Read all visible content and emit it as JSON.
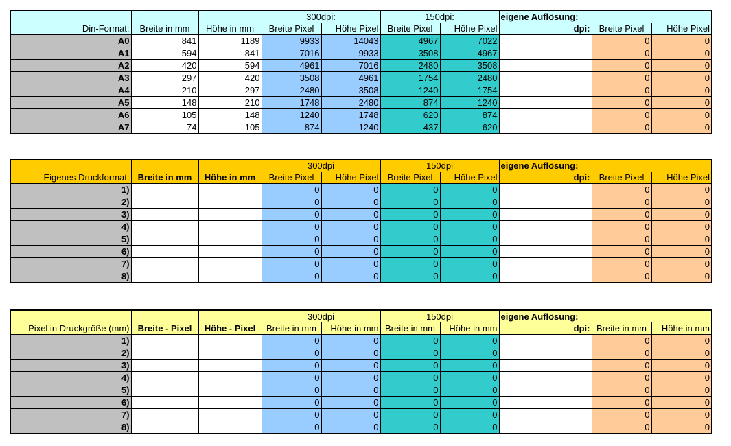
{
  "table1": {
    "header_dpi": {
      "dpi300": "300dpi:",
      "dpi150": "150dpi:",
      "custom": "eigene Auflösung:"
    },
    "header_cols": {
      "label": "Din-Format:",
      "w": "Breite in mm",
      "h": "Höhe in mm",
      "w300": "Breite Pixel",
      "h300": "Höhe Pixel",
      "w150": "Breite Pixel",
      "h150": "Höhe Pixel",
      "dpi": "dpi:",
      "wc": "Breite Pixel",
      "hc": "Höhe Pixel"
    },
    "rows": [
      {
        "label": "A0",
        "w": "841",
        "h": "1189",
        "w300": "9933",
        "h300": "14043",
        "w150": "4967",
        "h150": "7022",
        "dpi": "",
        "wc": "0",
        "hc": "0"
      },
      {
        "label": "A1",
        "w": "594",
        "h": "841",
        "w300": "7016",
        "h300": "9933",
        "w150": "3508",
        "h150": "4967",
        "dpi": "",
        "wc": "0",
        "hc": "0"
      },
      {
        "label": "A2",
        "w": "420",
        "h": "594",
        "w300": "4961",
        "h300": "7016",
        "w150": "2480",
        "h150": "3508",
        "dpi": "",
        "wc": "0",
        "hc": "0"
      },
      {
        "label": "A3",
        "w": "297",
        "h": "420",
        "w300": "3508",
        "h300": "4961",
        "w150": "1754",
        "h150": "2480",
        "dpi": "",
        "wc": "0",
        "hc": "0"
      },
      {
        "label": "A4",
        "w": "210",
        "h": "297",
        "w300": "2480",
        "h300": "3508",
        "w150": "1240",
        "h150": "1754",
        "dpi": "",
        "wc": "0",
        "hc": "0"
      },
      {
        "label": "A5",
        "w": "148",
        "h": "210",
        "w300": "1748",
        "h300": "2480",
        "w150": "874",
        "h150": "1240",
        "dpi": "",
        "wc": "0",
        "hc": "0"
      },
      {
        "label": "A6",
        "w": "105",
        "h": "148",
        "w300": "1240",
        "h300": "1748",
        "w150": "620",
        "h150": "874",
        "dpi": "",
        "wc": "0",
        "hc": "0"
      },
      {
        "label": "A7",
        "w": "74",
        "h": "105",
        "w300": "874",
        "h300": "1240",
        "w150": "437",
        "h150": "620",
        "dpi": "",
        "wc": "0",
        "hc": "0"
      }
    ]
  },
  "table2": {
    "header_dpi": {
      "dpi300": "300dpi",
      "dpi150": "150dpi",
      "custom": "eigene Auflösung:"
    },
    "header_cols": {
      "label": "Eigenes Druckformat:",
      "w": "Breite in mm",
      "h": "Höhe in mm",
      "w300": "Breite Pixel",
      "h300": "Höhe Pixel",
      "w150": "Breite Pixel",
      "h150": "Höhe Pixel",
      "dpi": "dpi:",
      "wc": "Breite Pixel",
      "hc": "Höhe Pixel"
    },
    "rows": [
      {
        "label": "1)",
        "w": "",
        "h": "",
        "w300": "0",
        "h300": "0",
        "w150": "0",
        "h150": "0",
        "dpi": "",
        "wc": "0",
        "hc": "0"
      },
      {
        "label": "2)",
        "w": "",
        "h": "",
        "w300": "0",
        "h300": "0",
        "w150": "0",
        "h150": "0",
        "dpi": "",
        "wc": "0",
        "hc": "0"
      },
      {
        "label": "3)",
        "w": "",
        "h": "",
        "w300": "0",
        "h300": "0",
        "w150": "0",
        "h150": "0",
        "dpi": "",
        "wc": "0",
        "hc": "0"
      },
      {
        "label": "4)",
        "w": "",
        "h": "",
        "w300": "0",
        "h300": "0",
        "w150": "0",
        "h150": "0",
        "dpi": "",
        "wc": "0",
        "hc": "0"
      },
      {
        "label": "5)",
        "w": "",
        "h": "",
        "w300": "0",
        "h300": "0",
        "w150": "0",
        "h150": "0",
        "dpi": "",
        "wc": "0",
        "hc": "0"
      },
      {
        "label": "6)",
        "w": "",
        "h": "",
        "w300": "0",
        "h300": "0",
        "w150": "0",
        "h150": "0",
        "dpi": "",
        "wc": "0",
        "hc": "0"
      },
      {
        "label": "7)",
        "w": "",
        "h": "",
        "w300": "0",
        "h300": "0",
        "w150": "0",
        "h150": "0",
        "dpi": "",
        "wc": "0",
        "hc": "0"
      },
      {
        "label": "8)",
        "w": "",
        "h": "",
        "w300": "0",
        "h300": "0",
        "w150": "0",
        "h150": "0",
        "dpi": "",
        "wc": "0",
        "hc": "0"
      }
    ]
  },
  "table3": {
    "header_dpi": {
      "dpi300": "300dpi",
      "dpi150": "150dpi",
      "custom": "eigene Auflösung:"
    },
    "header_cols": {
      "label": "Pixel in Druckgröße (mm)",
      "w": "Breite - Pixel",
      "h": "Höhe - Pixel",
      "w300": "Breite in mm",
      "h300": "Höhe in mm",
      "w150": "Breite in mm",
      "h150": "Höhe in mm",
      "dpi": "dpi:",
      "wc": "Breite in mm",
      "hc": "Höhe in mm"
    },
    "rows": [
      {
        "label": "1)",
        "w": "",
        "h": "",
        "w300": "0",
        "h300": "0",
        "w150": "0",
        "h150": "0",
        "dpi": "",
        "wc": "0",
        "hc": "0"
      },
      {
        "label": "2)",
        "w": "",
        "h": "",
        "w300": "0",
        "h300": "0",
        "w150": "0",
        "h150": "0",
        "dpi": "",
        "wc": "0",
        "hc": "0"
      },
      {
        "label": "3)",
        "w": "",
        "h": "",
        "w300": "0",
        "h300": "0",
        "w150": "0",
        "h150": "0",
        "dpi": "",
        "wc": "0",
        "hc": "0"
      },
      {
        "label": "4)",
        "w": "",
        "h": "",
        "w300": "0",
        "h300": "0",
        "w150": "0",
        "h150": "0",
        "dpi": "",
        "wc": "0",
        "hc": "0"
      },
      {
        "label": "5)",
        "w": "",
        "h": "",
        "w300": "0",
        "h300": "0",
        "w150": "0",
        "h150": "0",
        "dpi": "",
        "wc": "0",
        "hc": "0"
      },
      {
        "label": "6)",
        "w": "",
        "h": "",
        "w300": "0",
        "h300": "0",
        "w150": "0",
        "h150": "0",
        "dpi": "",
        "wc": "0",
        "hc": "0"
      },
      {
        "label": "7)",
        "w": "",
        "h": "",
        "w300": "0",
        "h300": "0",
        "w150": "0",
        "h150": "0",
        "dpi": "",
        "wc": "0",
        "hc": "0"
      },
      {
        "label": "8)",
        "w": "",
        "h": "",
        "w300": "0",
        "h300": "0",
        "w150": "0",
        "h150": "0",
        "dpi": "",
        "wc": "0",
        "hc": "0"
      }
    ]
  },
  "colors": {
    "label_grey": "#c0c0c0",
    "blue": "#99ccff",
    "teal": "#33cccc",
    "orange": "#ffcc99",
    "header_cyan": "#ccffff",
    "header_gold": "#ffcc00",
    "header_yellow": "#ffff99"
  }
}
